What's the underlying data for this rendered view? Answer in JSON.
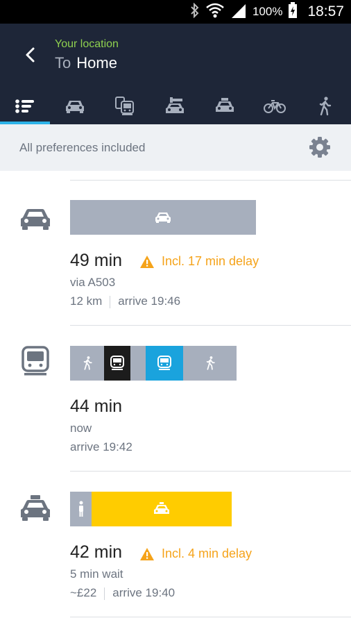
{
  "status_bar": {
    "battery": "100%",
    "time": "18:57"
  },
  "header": {
    "from": "Your location",
    "to_word": "To",
    "destination": "Home"
  },
  "mode_tabs": [
    "list-icon",
    "car-icon",
    "transit-icon",
    "car-share-icon",
    "taxi-icon",
    "bike-icon",
    "walk-icon"
  ],
  "preferences": {
    "label": "All preferences included"
  },
  "routes": [
    {
      "mode": "car",
      "duration": "49 min",
      "delay": "Incl. 17 min delay",
      "line1": "via A503",
      "distance": "12 km",
      "arrive": "arrive 19:46"
    },
    {
      "mode": "transit",
      "duration": "44 min",
      "line1": "now",
      "arrive": "arrive 19:42"
    },
    {
      "mode": "taxi",
      "duration": "42 min",
      "delay": "Incl. 4 min delay",
      "line1": "5 min wait",
      "cost": "~£22",
      "arrive": "arrive 19:40"
    }
  ],
  "colors": {
    "header": "#1e2638",
    "accent": "#2db3e8",
    "location_green": "#8fd14f",
    "delay_orange": "#f5a31a",
    "bar_gray": "#a7afbd",
    "tube_black": "#1c1c1c",
    "tube_blue": "#1aa3dd",
    "taxi_yellow": "#ffcc00"
  }
}
